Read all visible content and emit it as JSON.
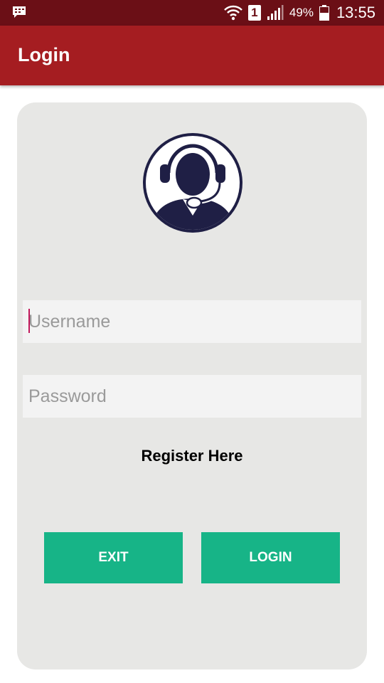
{
  "status_bar": {
    "battery_percent": "49%",
    "time": "13:55",
    "sim_slot": "1"
  },
  "app_bar": {
    "title": "Login"
  },
  "form": {
    "username_placeholder": "Username",
    "password_placeholder": "Password",
    "register_link": "Register Here",
    "exit_label": "EXIT",
    "login_label": "LOGIN"
  },
  "colors": {
    "status_bar": "#6b0f16",
    "app_bar": "#a51d21",
    "card": "#e7e7e5",
    "button": "#17b487",
    "avatar": "#1f1f45"
  },
  "icons": [
    "message-icon",
    "wifi-icon",
    "sim-icon",
    "signal-icon",
    "battery-icon",
    "support-agent-icon"
  ]
}
